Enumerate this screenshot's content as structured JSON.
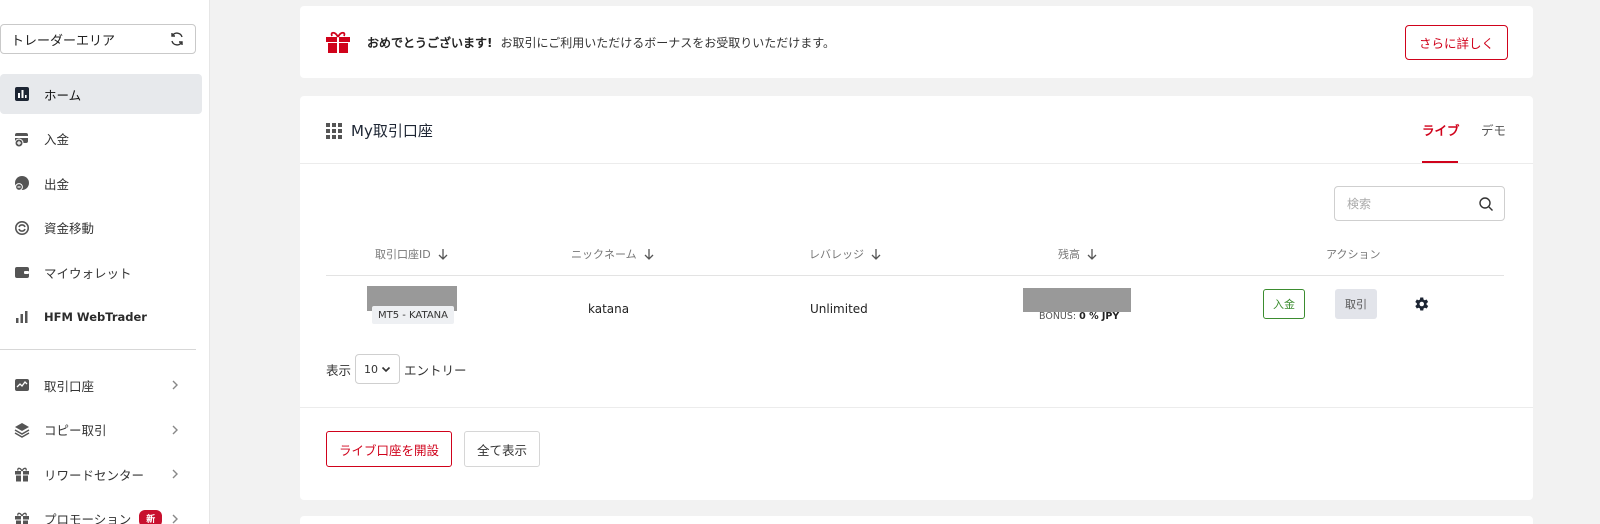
{
  "sidebar": {
    "area_select": "トレーダーエリア",
    "items": [
      {
        "label": "ホーム",
        "icon": "chart-icon"
      },
      {
        "label": "入金",
        "icon": "deposit-icon"
      },
      {
        "label": "出金",
        "icon": "withdraw-icon"
      },
      {
        "label": "資金移動",
        "icon": "transfer-icon"
      },
      {
        "label": "マイウォレット",
        "icon": "wallet-icon"
      },
      {
        "label": "HFM WebTrader",
        "icon": "bar-chart-icon"
      }
    ],
    "items2": [
      {
        "label": "取引口座",
        "icon": "trading-accounts-icon"
      },
      {
        "label": "コピー取引",
        "icon": "layers-icon"
      },
      {
        "label": "リワードセンター",
        "icon": "gift-icon"
      },
      {
        "label": "プロモーション",
        "icon": "gift-icon",
        "badge": "新"
      }
    ]
  },
  "banner": {
    "strong": "おめでとうございます!",
    "text": "お取引にご利用いただけるボーナスをお受取りいただけます。",
    "button": "さらに詳しく"
  },
  "accounts": {
    "title": "My取引口座",
    "tabs": {
      "live": "ライブ",
      "demo": "デモ"
    },
    "search_placeholder": "検索",
    "columns": [
      "取引口座ID",
      "ニックネーム",
      "レバレッジ",
      "残高",
      "アクション"
    ],
    "rows": [
      {
        "account_type": "MT5 - KATANA",
        "nickname": "katana",
        "leverage": "Unlimited",
        "bonus_label": "BONUS:",
        "bonus_value": "0 % JPY",
        "deposit": "入金",
        "trade": "取引"
      }
    ],
    "entries": {
      "prefix": "表示",
      "value": "10",
      "suffix": "エントリー"
    },
    "open_live": "ライブ口座を開設",
    "show_all": "全て表示"
  },
  "colors": {
    "accent": "#d0021b",
    "deposit_green": "#3b8c2f",
    "active_nav": "#e7e9ec"
  }
}
